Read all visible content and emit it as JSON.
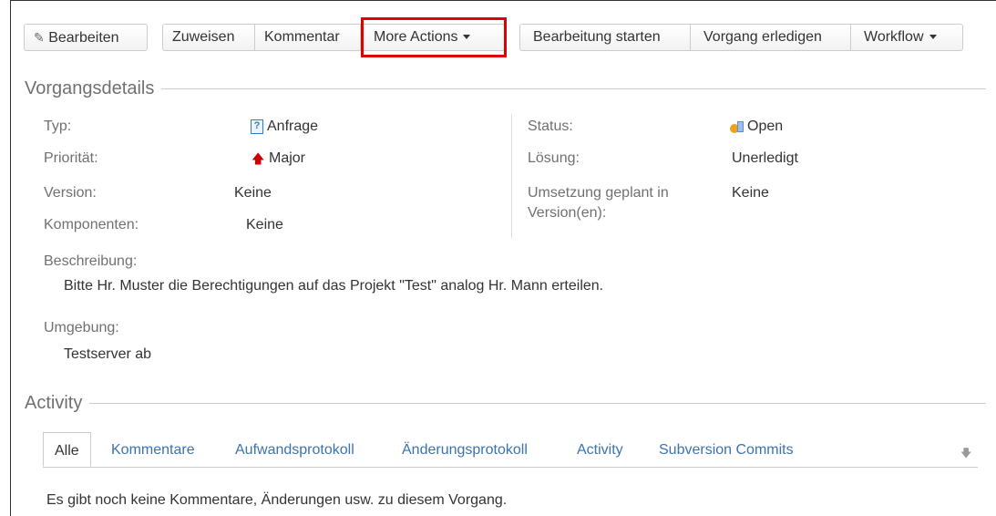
{
  "toolbar": {
    "edit_label": "Bearbeiten",
    "assign_label": "Zuweisen",
    "comment_label": "Kommentar",
    "more_actions_label": "More Actions",
    "start_progress_label": "Bearbeitung starten",
    "resolve_label": "Vorgang erledigen",
    "workflow_label": "Workflow"
  },
  "details": {
    "heading": "Vorgangsdetails",
    "type_label": "Typ:",
    "type_value": "Anfrage",
    "priority_label": "Priorität:",
    "priority_value": "Major",
    "version_label": "Version:",
    "version_value": "Keine",
    "components_label": "Komponenten:",
    "components_value": "Keine",
    "status_label": "Status:",
    "status_value": "Open",
    "resolution_label": "Lösung:",
    "resolution_value": "Unerledigt",
    "fix_version_label_line1": "Umsetzung geplant in",
    "fix_version_label_line2": "Version(en):",
    "fix_version_value": "Keine",
    "description_label": "Beschreibung:",
    "description_value": "Bitte Hr. Muster die Berechtigungen auf das Projekt \"Test\" analog Hr. Mann erteilen.",
    "environment_label": "Umgebung:",
    "environment_value": "Testserver ab"
  },
  "activity": {
    "heading": "Activity",
    "tabs": [
      "Alle",
      "Kommentare",
      "Aufwandsprotokoll",
      "Änderungsprotokoll",
      "Activity",
      "Subversion Commits"
    ],
    "empty_message": "Es gibt noch keine Kommentare, Änderungen usw. zu diesem Vorgang."
  },
  "colors": {
    "link": "#3b73af",
    "highlight": "#e00000",
    "label": "#707070"
  },
  "icons": {
    "edit": "pencil-icon",
    "type": "question-document-icon",
    "priority": "up-arrow-icon",
    "status": "open-status-icon",
    "sort": "down-arrow-icon"
  }
}
